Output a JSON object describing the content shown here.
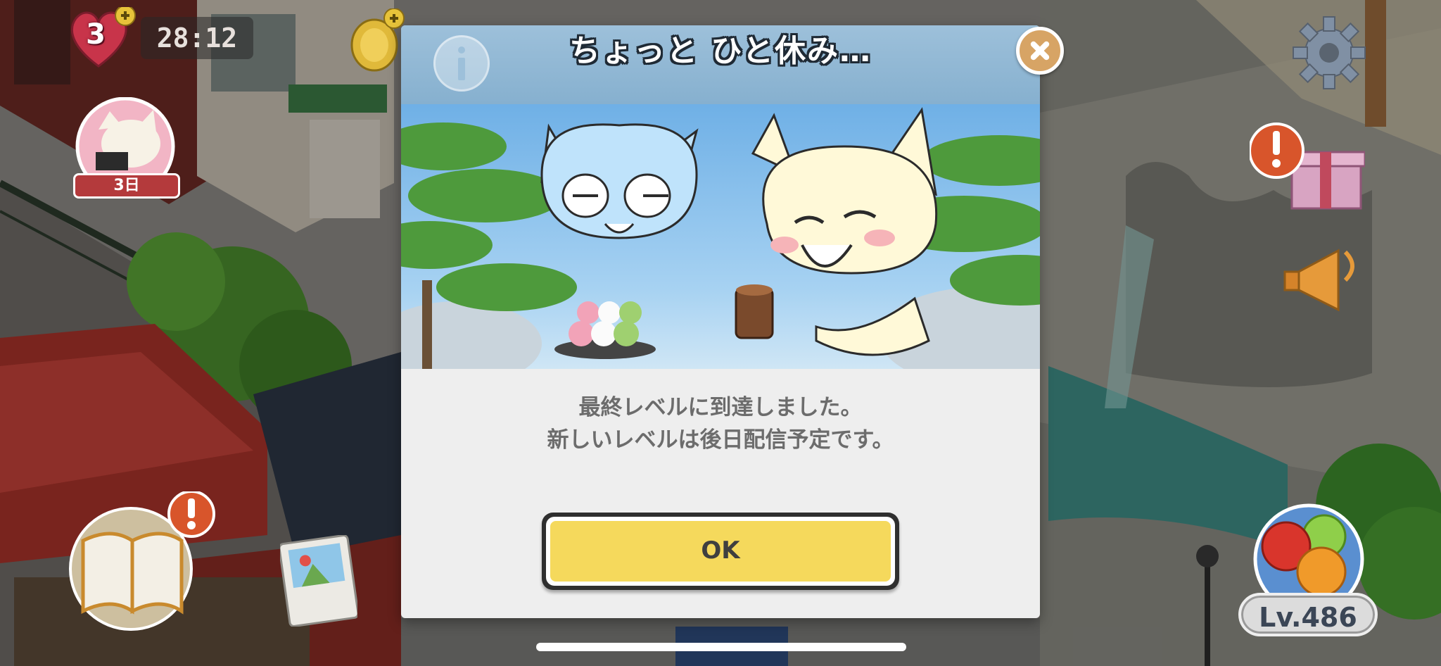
{
  "hud": {
    "lives": "3",
    "timer": "28:12",
    "login_bonus_days": "3日",
    "level": "Lv.486"
  },
  "dialog": {
    "title": "ちょっと ひと休み…",
    "message_line1": "最終レベルに到達しました。",
    "message_line2": "新しいレベルは後日配信予定です。",
    "ok_label": "OK"
  },
  "colors": {
    "header_blue": "#8fb6d4",
    "ok_yellow": "#f5d95c",
    "close_orange": "#d7a465",
    "dialog_bg": "#eeeeee"
  },
  "icons": [
    "heart-icon",
    "coin-icon",
    "info-icon",
    "close-icon",
    "gear-icon",
    "gift-icon",
    "megaphone-icon",
    "book-icon",
    "photo-icon",
    "fruit-icon"
  ]
}
